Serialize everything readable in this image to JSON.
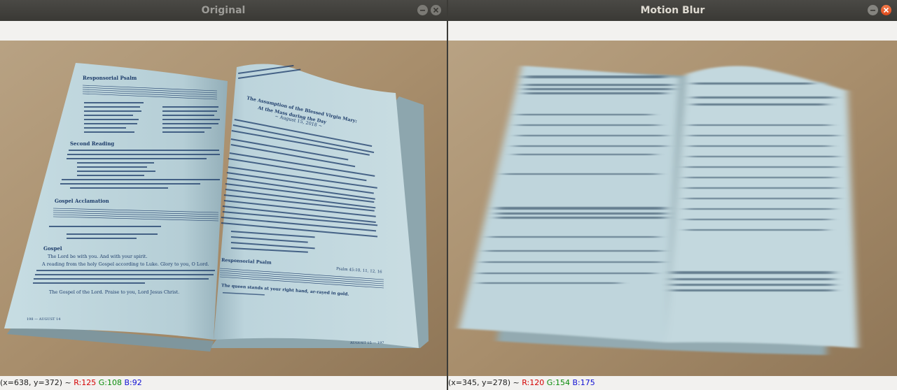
{
  "windows": [
    {
      "title": "Original",
      "status": {
        "coords": "(x=638, y=372) ~",
        "r": "R:125",
        "g": "G:108",
        "b": "B:92"
      }
    },
    {
      "title": "Motion Blur",
      "status": {
        "coords": "(x=345, y=278) ~",
        "r": "R:120",
        "g": "G:154",
        "b": "B:175"
      }
    }
  ],
  "book": {
    "left_page": {
      "header": "Responsorial Psalm",
      "second_reading": "Second Reading",
      "gospel_acclamation": "Gospel Acclamation",
      "gospel": "Gospel",
      "lines": [
        "The Lord be with you. And with your spirit.",
        "A reading from the holy Gospel according to Luke. Glory to you, O Lord.",
        "The Gospel of the Lord. Praise to you, Lord Jesus Christ."
      ],
      "footer": "198 — AUGUST 14"
    },
    "right_page": {
      "heading_1": "The Assumption of the Blessed Virgin Mary:",
      "heading_2": "At the Mass during the Day",
      "date": "~ August 15, 2018 ~",
      "responsorial": "Responsorial Psalm",
      "psalm_ref": "Psalm 45:10, 11, 12, 16",
      "music_text": "The queen stands at your right hand, ar-rayed in gold.",
      "footer": "AUGUST 15 — 197"
    }
  },
  "colors": {
    "titlebar": "#3c3b37",
    "close_button_active": "#e95420",
    "page_tint": "#b9d3dc",
    "desk": "#a8906e"
  },
  "icons": {
    "minimize": "minimize-icon",
    "close": "close-icon"
  }
}
